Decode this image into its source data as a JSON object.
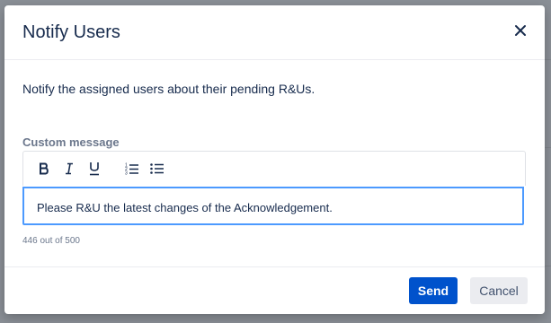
{
  "dialog": {
    "title": "Notify Users",
    "description": "Notify the assigned users about their pending R&Us.",
    "close_icon": "close-icon"
  },
  "custom_message": {
    "label": "Custom message",
    "value": "Please R&U the latest changes of the Acknowledgement.",
    "counter": "446 out of 500",
    "toolbar": [
      "bold-icon",
      "italic-icon",
      "underline-icon",
      "ordered-list-icon",
      "bullet-list-icon"
    ]
  },
  "footer": {
    "send_label": "Send",
    "cancel_label": "Cancel"
  },
  "colors": {
    "primary": "#0052cc",
    "focus_border": "#4c9aff",
    "text": "#172b4d",
    "muted": "#6b778c",
    "overlay": "#8a8f96"
  }
}
